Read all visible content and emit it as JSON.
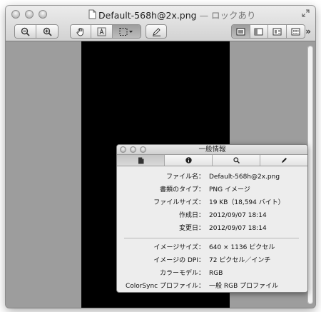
{
  "window": {
    "title_file": "Default-568h@2x.png",
    "title_separator": " — ",
    "title_status": "ロックあり"
  },
  "toolbar": {
    "buttons": [
      "zoom-out-icon",
      "zoom-in-icon",
      "hand-icon",
      "text-select-icon",
      "rect-select-icon",
      "annotate-icon",
      "single-page-icon",
      "sidebar-icon",
      "sidebar-right-icon",
      "contact-sheet-icon"
    ],
    "more": "»"
  },
  "inspector": {
    "title": "一般情報",
    "tabs": [
      "general-info-icon",
      "info-icon",
      "search-icon",
      "pen-icon"
    ],
    "rows": [
      {
        "label": "ファイル名：",
        "value": "Default-568h@2x.png"
      },
      {
        "label": "書類のタイプ：",
        "value": "PNG イメージ"
      },
      {
        "label": "ファイルサイズ：",
        "value": "19 KB（18,594 バイト）"
      },
      {
        "label": "作成日：",
        "value": "2012/09/07 18:14"
      },
      {
        "label": "変更日：",
        "value": "2012/09/07 18:14"
      },
      {
        "label": "イメージサイズ：",
        "value": "640 × 1136 ピクセル"
      },
      {
        "label": "イメージの DPI：",
        "value": "72 ピクセル／インチ"
      },
      {
        "label": "カラーモデル：",
        "value": "RGB"
      },
      {
        "label": "ColorSync プロファイル：",
        "value": "一般 RGB プロファイル"
      }
    ]
  },
  "colors": {
    "content_bg": "#9d9d9d",
    "image": "#000000",
    "panel_bg": "#ededed"
  }
}
